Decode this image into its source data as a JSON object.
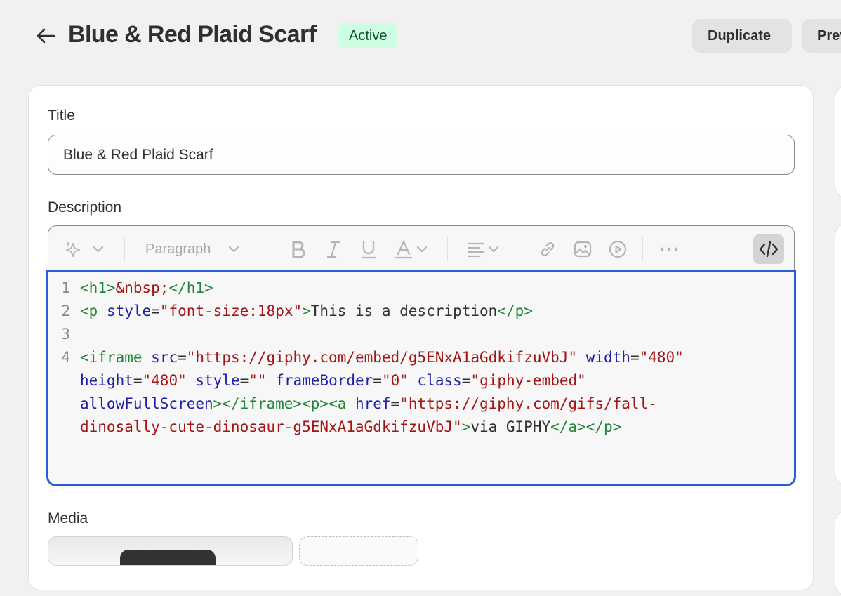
{
  "header": {
    "title": "Blue & Red Plaid Scarf",
    "status": "Active",
    "duplicate_label": "Duplicate",
    "preview_label": "Preview"
  },
  "form": {
    "title_label": "Title",
    "title_value": "Blue & Red Plaid Scarf",
    "description_label": "Description",
    "media_label": "Media"
  },
  "toolbar": {
    "paragraph_label": "Paragraph",
    "icons": [
      "magic-sparkle-icon",
      "chevron-down-icon",
      "bold-icon",
      "italic-icon",
      "underline-icon",
      "text-color-icon",
      "align-icon",
      "link-icon",
      "image-icon",
      "video-icon",
      "more-icon",
      "code-view-icon"
    ]
  },
  "code": {
    "line_numbers": [
      "1",
      "2",
      "3",
      "4"
    ],
    "l1_open": "<h1>",
    "l1_entity": "&nbsp;",
    "l1_close": "</h1>",
    "l2_open": "<p",
    "l2_attr": "style",
    "l2_eq": "=",
    "l2_val": "\"font-size:18px\"",
    "l2_gt": ">",
    "l2_text": "This is a description",
    "l2_close": "</p>",
    "l4_open": "<iframe",
    "l4_src": "src",
    "l4_src_val": "\"https://giphy.com/embed/g5ENxA1aGdkifzuVbJ\"",
    "l4_width": "width",
    "l4_width_val": "\"480\"",
    "l5_height": "height",
    "l5_height_val": "\"480\"",
    "l5_style": "style",
    "l5_style_val": "\"\"",
    "l5_fb": "frameBorder",
    "l5_fb_val": "\"0\"",
    "l5_class": "class",
    "l5_class_val": "\"giphy-embed\"",
    "l6_afs": "allowFullScreen",
    "l6_tags": "></iframe><p><a",
    "l6_href": "href",
    "l6_href_val1": "\"https://giphy.com/gifs/fall-",
    "l7_href_val2": "dinosally-cute-dinosaur-g5ENxA1aGdkifzuVbJ\"",
    "l7_gt": ">",
    "l7_text": "via GIPHY",
    "l7_close": "</a></p>"
  },
  "colors": {
    "accent_focus": "#2a5ed1",
    "badge_bg": "#cdfee1",
    "badge_text": "#0c5132",
    "tag": "#22863a",
    "attr": "#1f1fa8",
    "string": "#a31515"
  }
}
